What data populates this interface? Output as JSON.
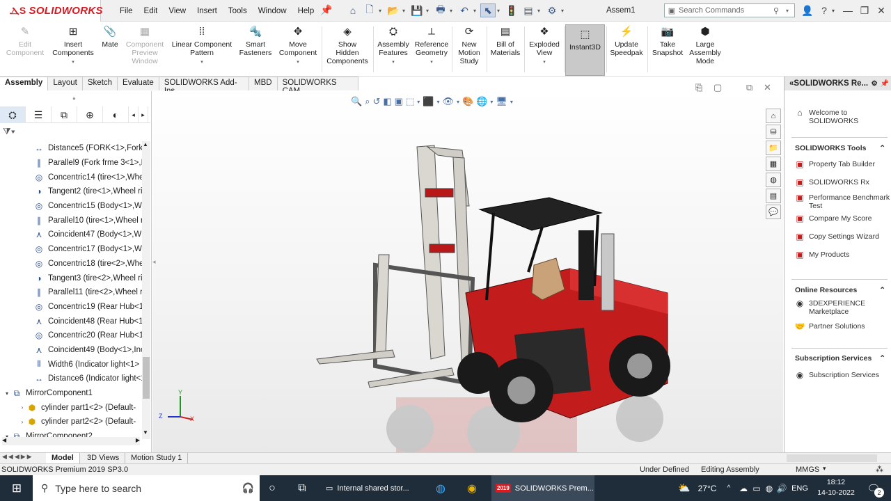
{
  "titlebar": {
    "app_name": "SOLIDWORKS",
    "doc_title": "Assem1",
    "search_placeholder": "Search Commands",
    "menus": [
      "File",
      "Edit",
      "View",
      "Insert",
      "Tools",
      "Window",
      "Help"
    ]
  },
  "ribbon": {
    "items": [
      {
        "label": "Edit\nComponent",
        "enabled": false,
        "icon": "edit-component-icon"
      },
      {
        "label": "Insert\nComponents",
        "enabled": true,
        "icon": "insert-components-icon"
      },
      {
        "label": "Mate",
        "enabled": true,
        "icon": "paperclip-icon"
      },
      {
        "label": "Component\nPreview\nWindow",
        "enabled": false,
        "icon": "preview-icon"
      },
      {
        "label": "Linear Component\nPattern",
        "enabled": true,
        "icon": "pattern-icon"
      },
      {
        "label": "Smart\nFasteners",
        "enabled": true,
        "icon": "fastener-icon"
      },
      {
        "label": "Move\nComponent",
        "enabled": true,
        "icon": "move-icon"
      },
      {
        "label": "Show\nHidden\nComponents",
        "enabled": true,
        "icon": "show-hidden-icon"
      },
      {
        "label": "Assembly\nFeatures",
        "enabled": true,
        "icon": "assembly-features-icon"
      },
      {
        "label": "Reference\nGeometry",
        "enabled": true,
        "icon": "reference-geometry-icon"
      },
      {
        "label": "New\nMotion\nStudy",
        "enabled": true,
        "icon": "motion-study-icon"
      },
      {
        "label": "Bill of\nMaterials",
        "enabled": true,
        "icon": "bom-icon"
      },
      {
        "label": "Exploded\nView",
        "enabled": true,
        "icon": "exploded-view-icon"
      },
      {
        "label": "Instant3D",
        "enabled": true,
        "icon": "instant3d-icon"
      },
      {
        "label": "Update\nSpeedpak",
        "enabled": true,
        "icon": "speedpak-icon"
      },
      {
        "label": "Take\nSnapshot",
        "enabled": true,
        "icon": "camera-icon"
      },
      {
        "label": "Large\nAssembly\nMode",
        "enabled": true,
        "icon": "large-assembly-icon"
      }
    ]
  },
  "command_tabs": [
    "Assembly",
    "Layout",
    "Sketch",
    "Evaluate",
    "SOLIDWORKS Add-Ins",
    "MBD",
    "SOLIDWORKS CAM"
  ],
  "tree": [
    {
      "label": "Distance5 (FORK<1>,Fork f",
      "icon": "distance-mate-icon"
    },
    {
      "label": "Parallel9 (Fork frme 3<1>,F",
      "icon": "parallel-mate-icon"
    },
    {
      "label": "Concentric14 (tire<1>,Whe",
      "icon": "concentric-mate-icon"
    },
    {
      "label": "Tangent2 (tire<1>,Wheel ri",
      "icon": "tangent-mate-icon"
    },
    {
      "label": "Concentric15 (Body<1>,Wl",
      "icon": "concentric-mate-icon"
    },
    {
      "label": "Parallel10 (tire<1>,Wheel ri",
      "icon": "parallel-mate-icon"
    },
    {
      "label": "Coincident47 (Body<1>,Wl",
      "icon": "coincident-mate-icon"
    },
    {
      "label": "Concentric17 (Body<1>,Wl",
      "icon": "concentric-mate-icon"
    },
    {
      "label": "Concentric18 (tire<2>,Whe",
      "icon": "concentric-mate-icon"
    },
    {
      "label": "Tangent3 (tire<2>,Wheel ri",
      "icon": "tangent-mate-icon"
    },
    {
      "label": "Parallel11 (tire<2>,Wheel ri",
      "icon": "parallel-mate-icon"
    },
    {
      "label": "Concentric19 (Rear Hub<1:",
      "icon": "concentric-mate-icon"
    },
    {
      "label": "Coincident48 (Rear Hub<1:",
      "icon": "coincident-mate-icon"
    },
    {
      "label": "Concentric20 (Rear Hub<1:",
      "icon": "concentric-mate-icon"
    },
    {
      "label": "Coincident49 (Body<1>,Inc",
      "icon": "coincident-mate-icon"
    },
    {
      "label": "Width6 (Indicator light<1>",
      "icon": "width-mate-icon"
    },
    {
      "label": "Distance6 (Indicator light<1",
      "icon": "distance-mate-icon"
    },
    {
      "label": "MirrorComponent1",
      "icon": "mirror-component-icon"
    },
    {
      "label": "cylinder part1<2> (Default-",
      "icon": "part-icon"
    },
    {
      "label": "cylinder part2<2> (Default-",
      "icon": "part-icon"
    },
    {
      "label": "MirrorComponent2",
      "icon": "mirror-component-icon"
    }
  ],
  "bottom_tabs": [
    "Model",
    "3D Views",
    "Motion Study 1"
  ],
  "status": {
    "product": "SOLIDWORKS Premium 2019 SP3.0",
    "state": "Under Defined",
    "mode": "Editing Assembly",
    "units": "MMGS"
  },
  "right_panel": {
    "title": "SOLIDWORKS Re...",
    "welcome": "Welcome to\nSOLIDWORKS",
    "tools_header": "SOLIDWORKS Tools",
    "tools": [
      "Property Tab Builder",
      "SOLIDWORKS Rx",
      "Performance Benchmark\nTest",
      "Compare My Score",
      "Copy Settings Wizard",
      "My Products"
    ],
    "online_header": "Online Resources",
    "online": [
      "3DEXPERIENCE\nMarketplace",
      "Partner Solutions"
    ],
    "subs_header": "Subscription Services",
    "subs": [
      "Subscription Services"
    ]
  },
  "taskbar": {
    "search_placeholder": "Type here to search",
    "shared_storage": "Internal shared stor...",
    "sw_app": "SOLIDWORKS Prem...",
    "sw_badge": "2019",
    "weather": "27°C",
    "lang": "ENG",
    "time": "18:12",
    "date": "14-10-2022",
    "notif_count": "2"
  },
  "axes": {
    "y": "Y",
    "z": "Z",
    "x": "X"
  }
}
